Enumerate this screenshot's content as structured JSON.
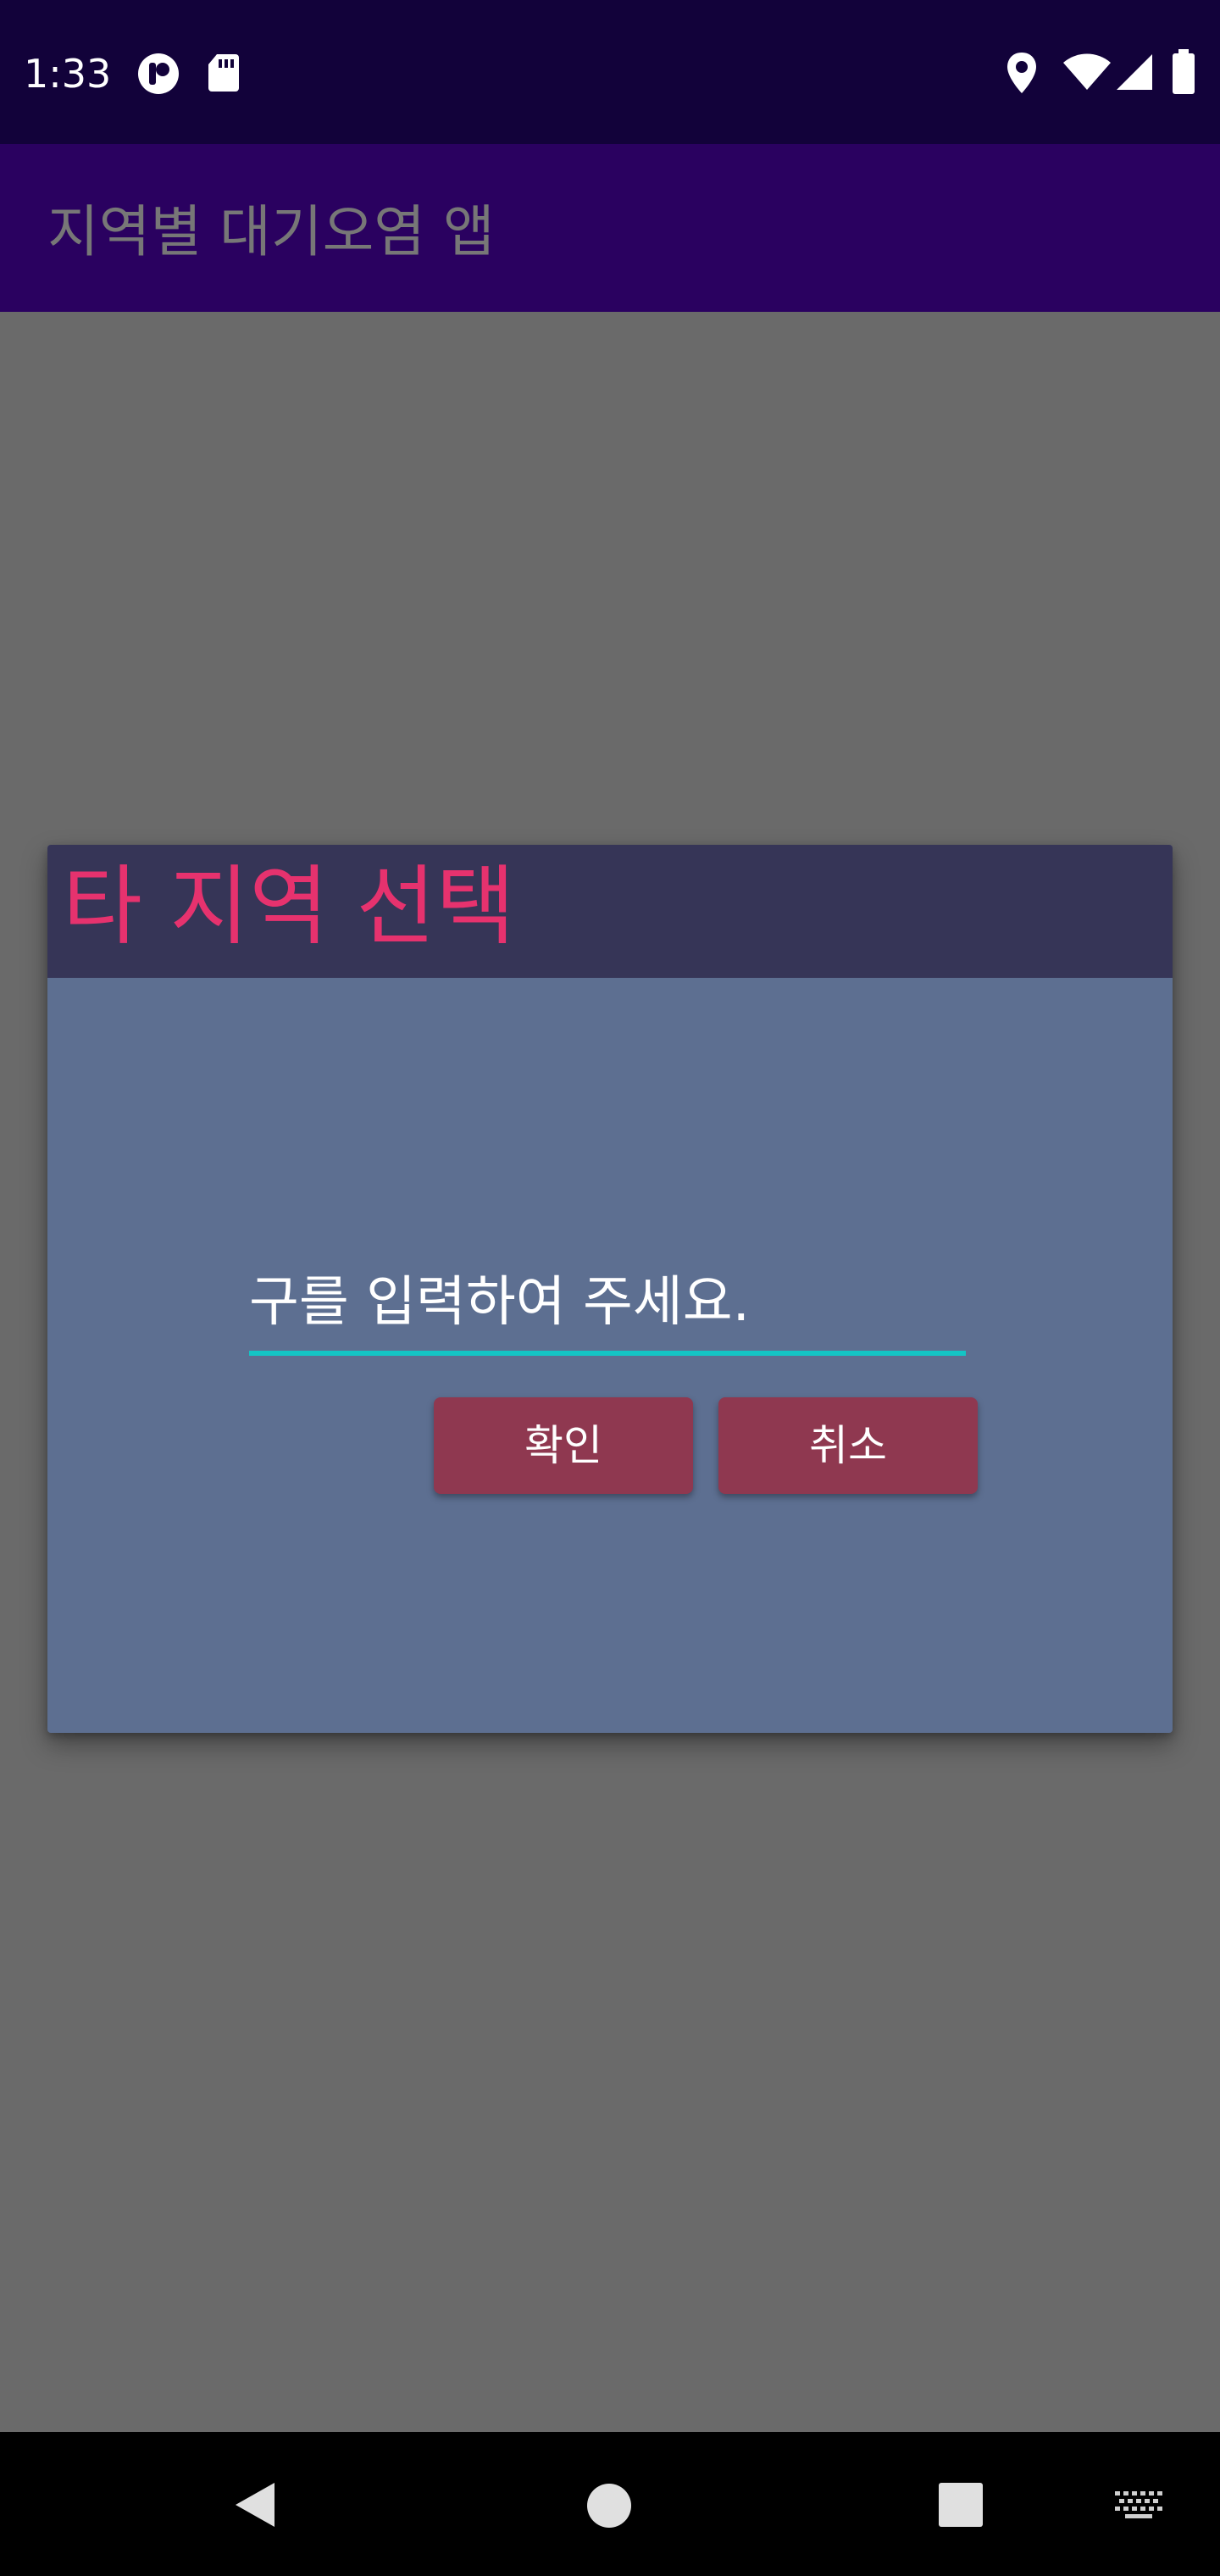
{
  "status_bar": {
    "time": "1:33",
    "icons": [
      "media-icon",
      "sd-card-icon",
      "location-icon",
      "wifi-icon",
      "signal-icon",
      "battery-icon"
    ]
  },
  "app_bar": {
    "title": "지역별 대기오염 앱"
  },
  "dialog": {
    "title": "타 지역 선택",
    "input": {
      "placeholder": "구를 입력하여 주세요.",
      "value": ""
    },
    "confirm_label": "확인",
    "cancel_label": "취소"
  },
  "nav_bar": {
    "icons": [
      "back-icon",
      "home-icon",
      "recents-icon",
      "keyboard-icon"
    ]
  },
  "colors": {
    "status_bar": "#12023a",
    "app_bar": "#2a0160",
    "scrim": "#6a6a6a",
    "dialog_body": "#5d6f91",
    "dialog_header": "#363557",
    "title_accent": "#e6326e",
    "input_underline": "#13c5c5",
    "button": "#8f3850"
  }
}
